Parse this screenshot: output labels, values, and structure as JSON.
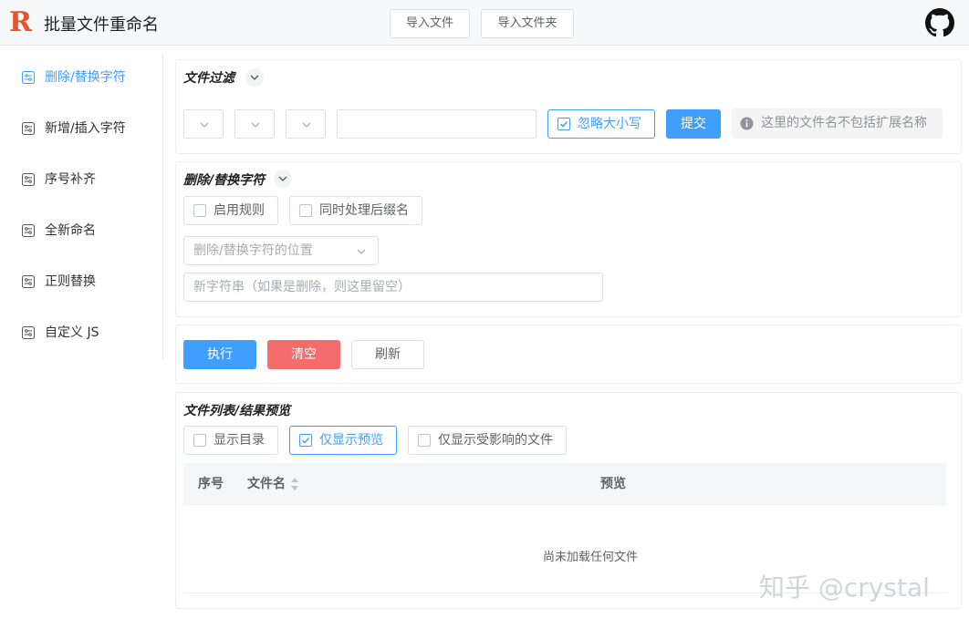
{
  "app": {
    "title": "批量文件重命名",
    "logo_letter": "R"
  },
  "header": {
    "import_file": "导入文件",
    "import_folder": "导入文件夹",
    "github_icon": "github-icon"
  },
  "sidebar": {
    "items": [
      {
        "label": "删除/替换字符",
        "active": true
      },
      {
        "label": "新增/插入字符"
      },
      {
        "label": "序号补齐"
      },
      {
        "label": "全新命名"
      },
      {
        "label": "正则替换"
      },
      {
        "label": "自定义 JS"
      }
    ]
  },
  "filter": {
    "title": "文件过滤",
    "ignore_case": "忽略大小写",
    "submit": "提交",
    "hint": "这里的文件名不包括扩展名称"
  },
  "replace": {
    "title": "删除/替换字符",
    "enable_rule": "启用规则",
    "process_suffix": "同时处理后缀名",
    "position_placeholder": "删除/替换字符的位置",
    "new_string_placeholder": "新字符串（如果是删除，则这里留空）"
  },
  "actions": {
    "execute": "执行",
    "clear": "清空",
    "refresh": "刷新"
  },
  "file_list": {
    "title": "文件列表/结果预览",
    "show_dirs": "显示目录",
    "preview_only": "仅显示预览",
    "affected_only": "仅显示受影响的文件",
    "columns": [
      "序号",
      "文件名",
      "预览"
    ],
    "empty_text": "尚未加载任何文件"
  },
  "watermark": "知乎 @crystal",
  "colors": {
    "primary": "#409eff",
    "danger": "#f56c6c",
    "logo": "#e8542c"
  }
}
